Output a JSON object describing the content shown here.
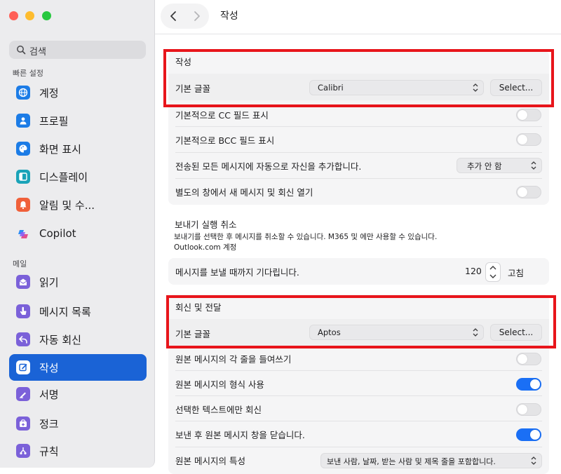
{
  "window": {
    "title": "작성"
  },
  "sidebar": {
    "search_placeholder": "검색",
    "section_quick": "빠른 설정",
    "section_mail": "메일",
    "items": [
      {
        "label": "계정",
        "icon": "globe-icon",
        "color": "#1c7ce6"
      },
      {
        "label": "프로필",
        "icon": "person-icon",
        "color": "#1c7ce6"
      },
      {
        "label": "화면 표시",
        "icon": "palette-icon",
        "color": "#1c7ce6"
      },
      {
        "label": "디스플레이",
        "icon": "layout-icon",
        "color": "#1aa3b8"
      },
      {
        "label": "알림 및 수...",
        "icon": "bell-icon",
        "color": "#f0603a"
      },
      {
        "label": "Copilot",
        "icon": "copilot-icon",
        "color": "#8a5cf6"
      },
      {
        "label": "읽기",
        "icon": "envelope-open-icon",
        "color": "#7b61d9"
      },
      {
        "label": "메시지 목록",
        "icon": "hand-pointer-icon",
        "color": "#7b61d9"
      },
      {
        "label": "자동 회신",
        "icon": "reply-icon",
        "color": "#7b61d9"
      },
      {
        "label": "작성",
        "icon": "compose-icon",
        "color": "#7b61d9",
        "active": true
      },
      {
        "label": "서명",
        "icon": "signature-icon",
        "color": "#7b61d9"
      },
      {
        "label": "정크",
        "icon": "junk-icon",
        "color": "#7b61d9"
      },
      {
        "label": "규칙",
        "icon": "rules-icon",
        "color": "#7b61d9"
      }
    ]
  },
  "compose": {
    "heading": "작성",
    "font_label": "기본 글꼴",
    "font_value": "Calibri",
    "select_label": "Select...",
    "cc_label": "기본적으로 CC 필드 표시",
    "cc_on": false,
    "bcc_label": "기본적으로 BCC 필드 표시",
    "bcc_on": false,
    "auto_add_label": "전송된 모든 메시지에 자동으로 자신을 추가합니다.",
    "auto_add_value": "추가 안 함",
    "new_window_label": "별도의 창에서 새 메시지 및 회신 열기",
    "new_window_on": false
  },
  "undo_send": {
    "title": "보내기 실행 취소",
    "description": "보내기를 선택한 후 메시지를 취소할 수 있습니다. M365 및 에만 사용할 수 있습니다.",
    "description2": "Outlook.com 계정",
    "wait_label": "메시지를 보낼 때까지 기다립니다.",
    "wait_value": "120",
    "wait_unit": "고침"
  },
  "reply": {
    "heading": "회신 및 전달",
    "font_label": "기본 글꼴",
    "font_value": "Aptos",
    "select_label": "Select...",
    "indent_label": "원본 메시지의 각 줄을 들여쓰기",
    "indent_on": false,
    "format_label": "원본 메시지의 형식 사용",
    "format_on": true,
    "selected_text_label": "선택한 텍스트에만 회신",
    "selected_text_on": false,
    "close_label": "보낸 후 원본 메시지 창을 닫습니다.",
    "close_on": true,
    "attributes_label": "원본 메시지의 특성",
    "attributes_value": "보낸 사람, 날짜, 받는 사람 및 제목 줄을 포함합니다."
  },
  "colors": {
    "accent": "#1a63d6",
    "highlight_box": "#e8151b",
    "toggle_on": "#1a6ff5"
  }
}
